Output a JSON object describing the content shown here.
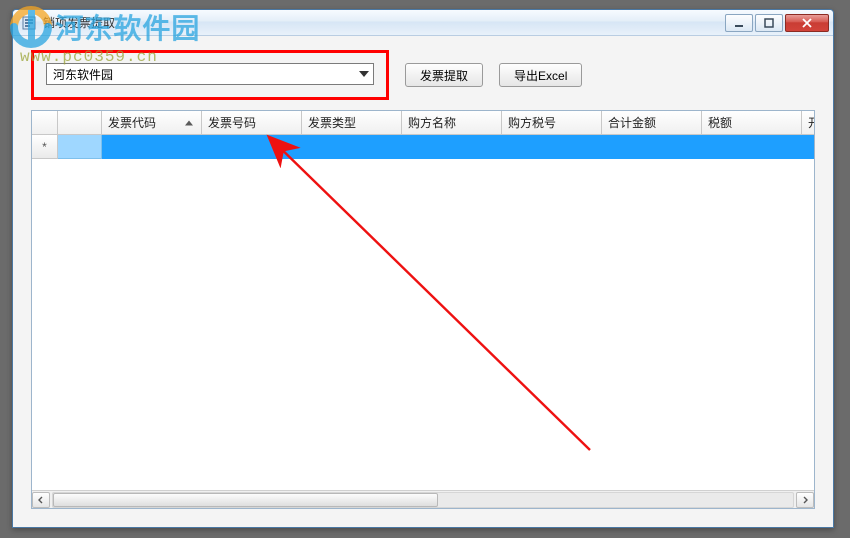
{
  "window": {
    "title": "销项发票提取"
  },
  "watermark": {
    "brand": "河东软件园",
    "url": "www.pc0359.cn"
  },
  "toolbar": {
    "combo_value": "河东软件园",
    "extract_label": "发票提取",
    "export_label": "导出Excel"
  },
  "grid": {
    "row_indicator": "*",
    "columns": [
      "发票代码",
      "发票号码",
      "发票类型",
      "购方名称",
      "购方税号",
      "合计金额",
      "税额",
      "开票"
    ],
    "rows": [
      {
        "cells": [
          "",
          "",
          "",
          "",
          "",
          "",
          "",
          ""
        ]
      }
    ]
  },
  "colors": {
    "highlight_border": "#ff0000",
    "selection_row": "#1e9fff",
    "grid_body_bg": "#d6ecff"
  }
}
